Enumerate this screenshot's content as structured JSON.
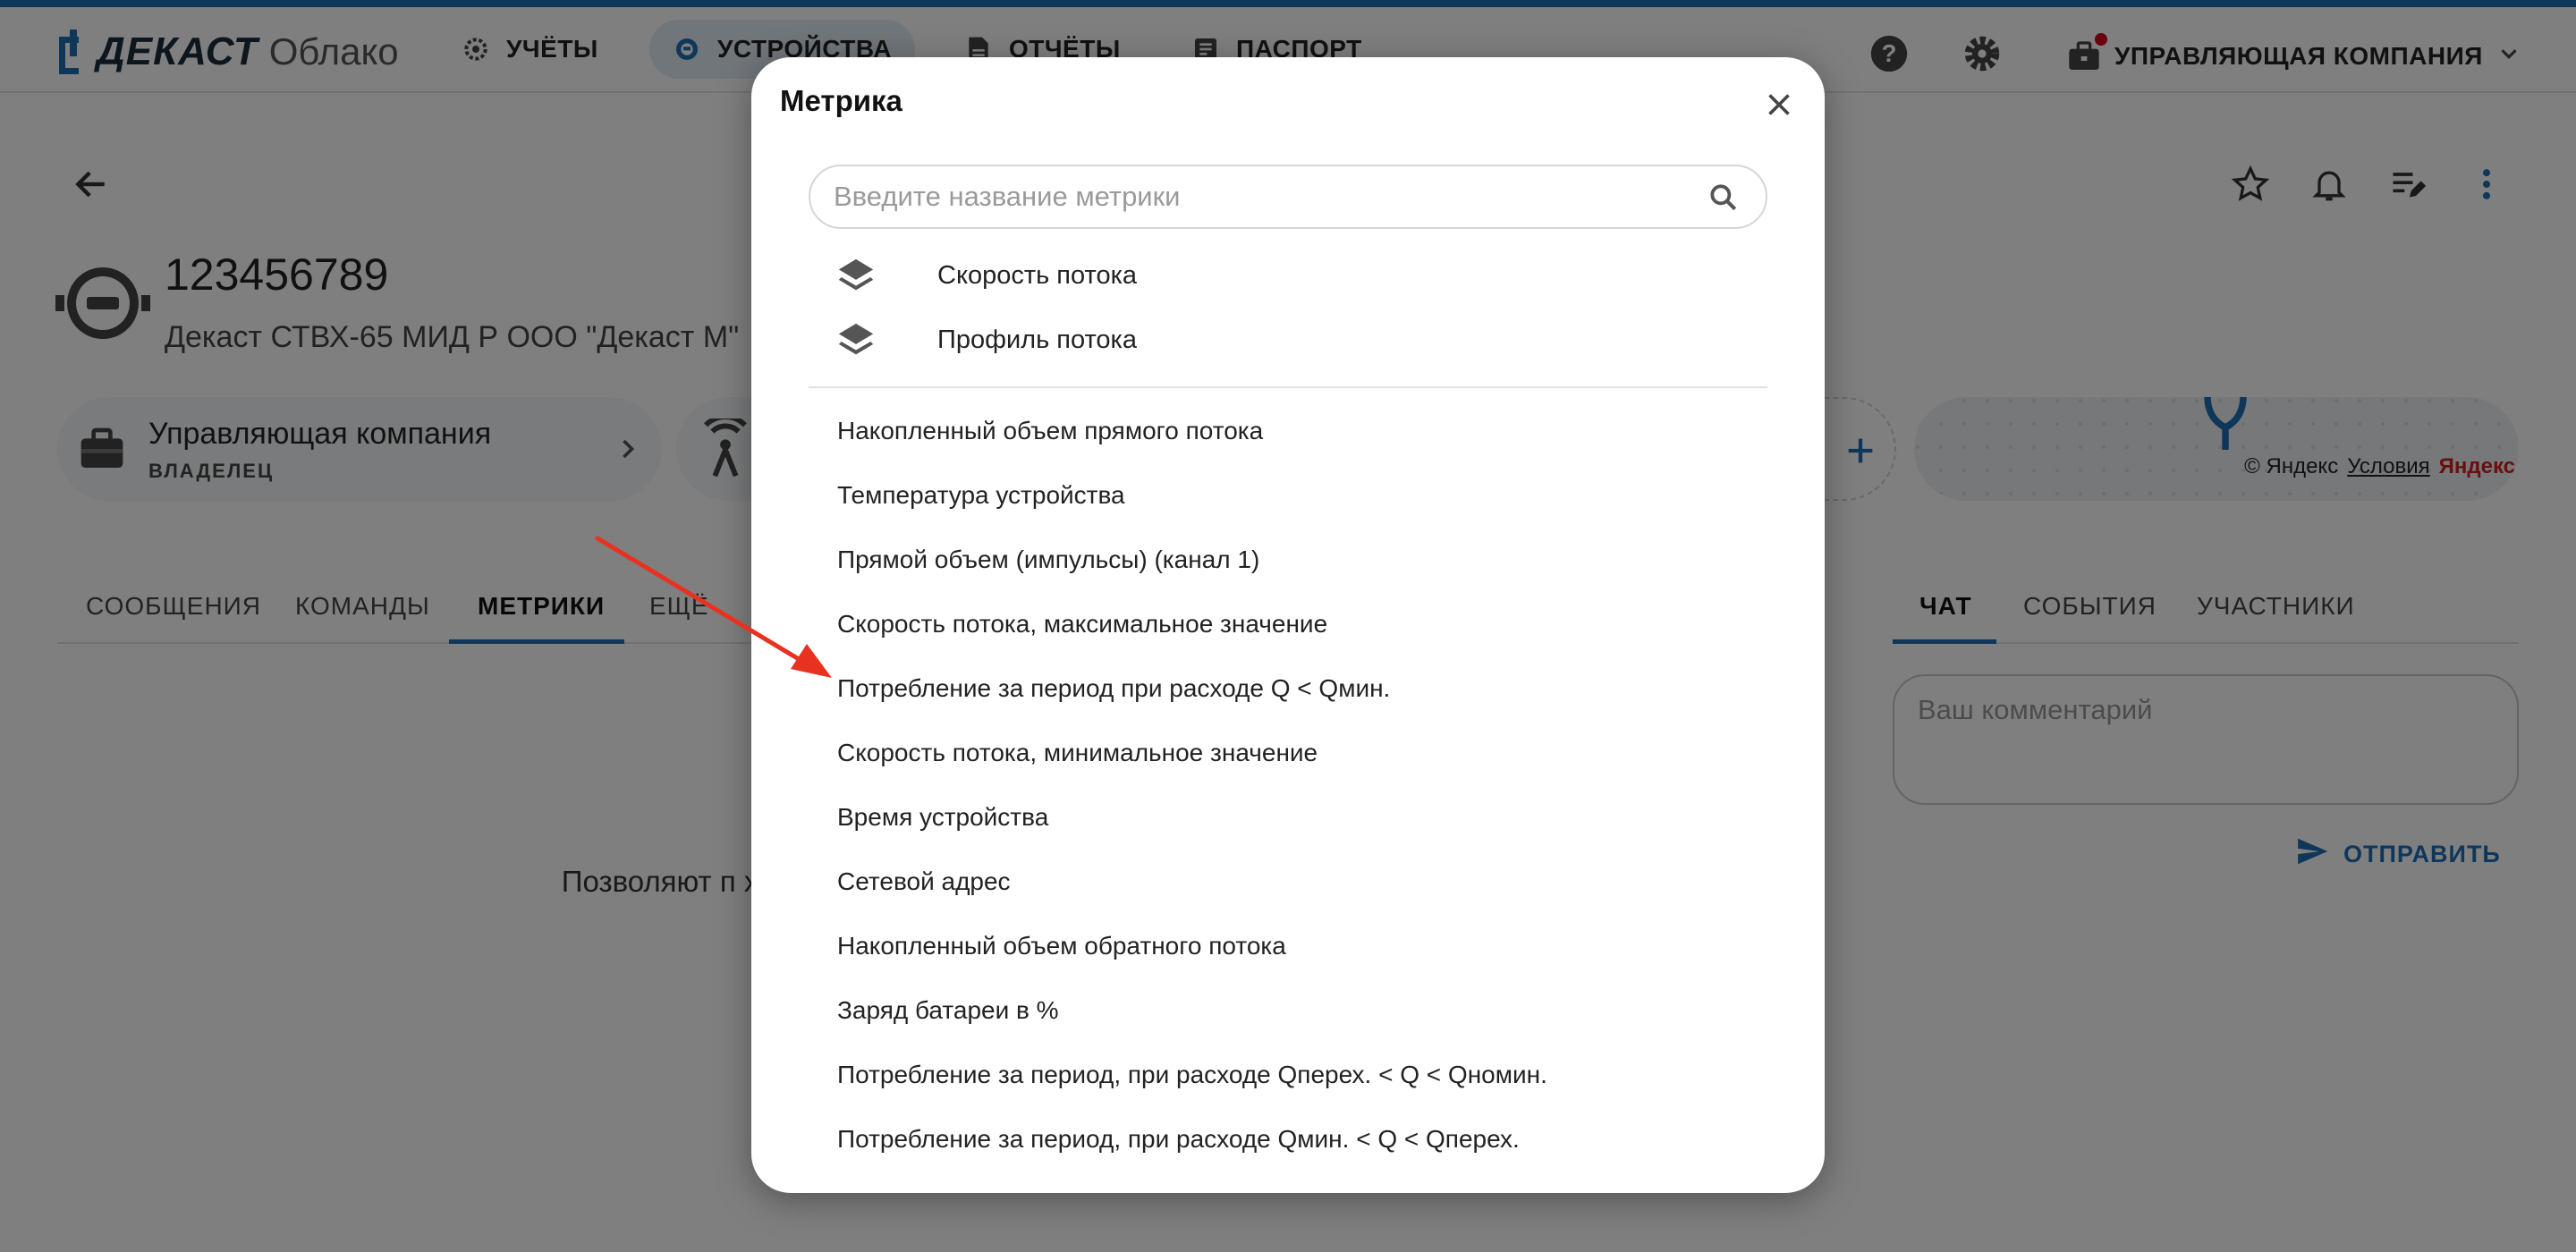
{
  "app": {
    "logo_word": "ДЕКАСТ",
    "logo_sub": "Облако",
    "nav": [
      {
        "label": "УЧЁТЫ"
      },
      {
        "label": "УСТРОЙСТВА"
      },
      {
        "label": "ОТЧЁТЫ"
      },
      {
        "label": "ПАСПОРТ"
      }
    ],
    "company": "УПРАВЛЯЮЩАЯ КОМПАНИЯ"
  },
  "device": {
    "id": "123456789",
    "model": "Декаст СТВХ-65 МИД Р ООО \"Декаст М\"",
    "owner_name": "Управляющая компания",
    "owner_role": "ВЛАДЕЛЕЦ"
  },
  "map": {
    "attribution": "© Яндекс",
    "terms": "Условия",
    "brand": "Яндекс"
  },
  "tabs_left": [
    "СООБЩЕНИЯ",
    "КОМАНДЫ",
    "МЕТРИКИ",
    "ЕЩЁ"
  ],
  "tabs_right": [
    "ЧАТ",
    "СОБЫТИЯ",
    "УЧАСТНИКИ"
  ],
  "empty_text": "Позволяют п характеристик",
  "comment": {
    "placeholder": "Ваш комментарий",
    "send_label": "ОТПРАВИТЬ"
  },
  "modal": {
    "title": "Метрика",
    "search_placeholder": "Введите название метрики",
    "groups": [
      {
        "label": "Скорость потока"
      },
      {
        "label": "Профиль потока"
      }
    ],
    "metrics": [
      "Накопленный объем прямого потока",
      "Температура устройства",
      "Прямой объем (импульсы) (канал 1)",
      "Скорость потока, максимальное значение",
      "Потребление за период при расходе Q < Qмин.",
      "Скорость потока, минимальное значение",
      "Время устройства",
      "Сетевой адрес",
      "Накопленный объем обратного потока",
      "Заряд батареи в %",
      "Потребление за период, при расходе Qперех. < Q < Qномин.",
      "Потребление за период, при расходе Qмин. < Q < Qперех."
    ]
  },
  "colors": {
    "accent": "#1f6fb5",
    "arrow": "#e8321f",
    "overlay": "rgba(0,0,0,0.5)"
  }
}
